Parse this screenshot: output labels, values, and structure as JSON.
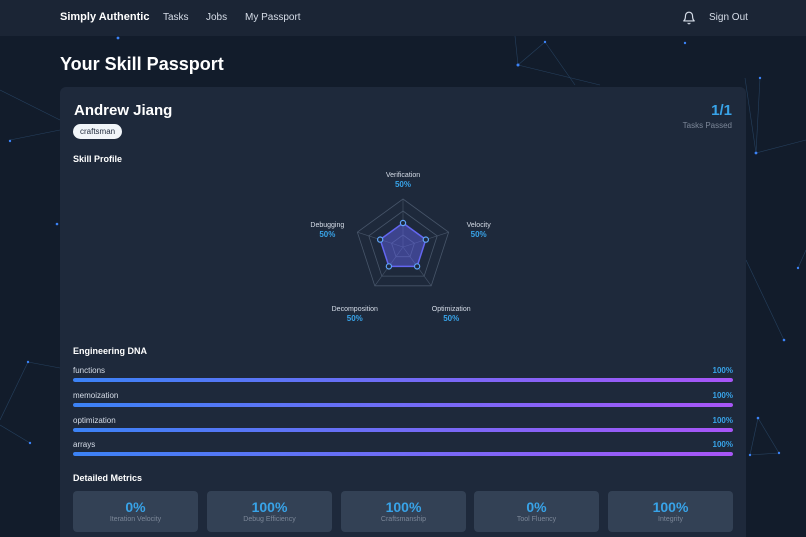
{
  "nav": {
    "brand": "Simply Authentic",
    "links": [
      "Tasks",
      "Jobs",
      "My Passport"
    ],
    "sign_out": "Sign Out"
  },
  "page": {
    "title": "Your Skill Passport"
  },
  "profile": {
    "name": "Andrew Jiang",
    "badge": "craftsman",
    "tasks_count": "1/1",
    "tasks_label": "Tasks Passed"
  },
  "skill_profile": {
    "title": "Skill Profile",
    "axes": [
      {
        "name": "Verification",
        "value_label": "50%",
        "value": 0.5
      },
      {
        "name": "Velocity",
        "value_label": "50%",
        "value": 0.5
      },
      {
        "name": "Optimization",
        "value_label": "50%",
        "value": 0.5
      },
      {
        "name": "Decomposition",
        "value_label": "50%",
        "value": 0.5
      },
      {
        "name": "Debugging",
        "value_label": "50%",
        "value": 0.5
      }
    ]
  },
  "engineering_dna": {
    "title": "Engineering DNA",
    "items": [
      {
        "label": "functions",
        "percent_label": "100%",
        "percent": 100
      },
      {
        "label": "memoization",
        "percent_label": "100%",
        "percent": 100
      },
      {
        "label": "optimization",
        "percent_label": "100%",
        "percent": 100
      },
      {
        "label": "arrays",
        "percent_label": "100%",
        "percent": 100
      }
    ]
  },
  "detailed_metrics": {
    "title": "Detailed Metrics",
    "items": [
      {
        "value": "0%",
        "label": "Iteration Velocity"
      },
      {
        "value": "100%",
        "label": "Debug Efficiency"
      },
      {
        "value": "100%",
        "label": "Craftsmanship"
      },
      {
        "value": "0%",
        "label": "Tool Fluency"
      },
      {
        "value": "100%",
        "label": "Integrity"
      }
    ]
  },
  "colors": {
    "accent": "#38a3e8",
    "background": "#121c2b",
    "card": "#1e293b",
    "bar_start": "#3b82f6",
    "bar_end": "#a855f7"
  },
  "icons": {
    "notifications": "bell-icon"
  }
}
